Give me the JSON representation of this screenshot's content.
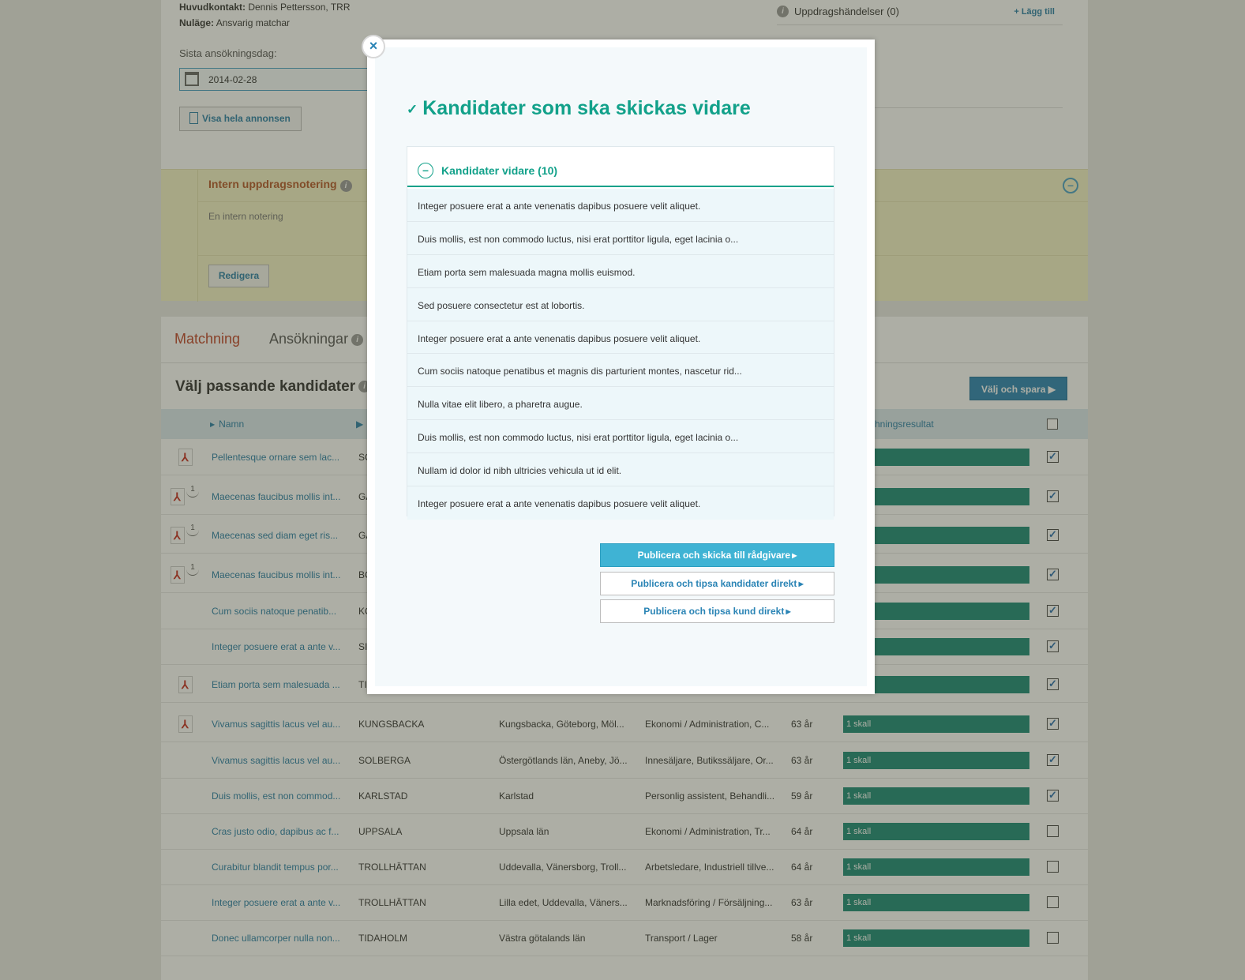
{
  "background": {
    "contact_label": "Huvudkontakt:",
    "contact_value": "Dennis Pettersson, TRR",
    "status_label": "Nuläge:",
    "status_value": "Ansvarig matchar",
    "deadline_label": "Sista ansökningsdag:",
    "deadline_value": "2014-02-28",
    "view_ad_label": "Visa hela annonsen",
    "events_label": "Uppdragshändelser (0)",
    "events_add": "+ Lägg till",
    "note_title": "Intern uppdragsnotering",
    "note_text": "En intern notering",
    "note_edit": "Redigera",
    "tab_matching": "Matchning",
    "tab_applications": "Ansökningar",
    "section_title": "Välj passande kandidater",
    "choose_save": "Välj och spara",
    "col_name": "Namn",
    "col_result": "hningsresultat",
    "rows": [
      {
        "name": "Pellentesque ornare sem lac...",
        "city": "SO",
        "area": "",
        "job": "",
        "age": "",
        "bar": "",
        "checked": "✓",
        "pdf": true,
        "one": false
      },
      {
        "name": "Maecenas faucibus mollis int...",
        "city": "GA",
        "area": "",
        "job": "",
        "age": "",
        "bar": "",
        "checked": "✓",
        "pdf": true,
        "one": true
      },
      {
        "name": "Maecenas sed diam eget ris...",
        "city": "GA",
        "area": "",
        "job": "",
        "age": "",
        "bar": "",
        "checked": "✓",
        "pdf": true,
        "one": true
      },
      {
        "name": "Maecenas faucibus mollis int...",
        "city": "BO",
        "area": "",
        "job": "",
        "age": "",
        "bar": "",
        "checked": "✓",
        "pdf": true,
        "one": true
      },
      {
        "name": "Cum sociis natoque penatib...",
        "city": "KO",
        "area": "",
        "job": "",
        "age": "",
        "bar": "",
        "checked": "✓",
        "pdf": false,
        "one": false
      },
      {
        "name": "Integer posuere erat a ante v...",
        "city": "SI",
        "area": "",
        "job": "",
        "age": "",
        "bar": "",
        "checked": "✓",
        "pdf": false,
        "one": false
      },
      {
        "name": "Etiam porta sem malesuada ...",
        "city": "TI",
        "area": "",
        "job": "",
        "age": "",
        "bar": "",
        "checked": "✓",
        "pdf": true,
        "one": false
      },
      {
        "name": "Vivamus sagittis lacus vel au...",
        "city": "KUNGSBACKA",
        "area": "Kungsbacka, Göteborg, Möl...",
        "job": "Ekonomi / Administration, C...",
        "age": "63 år",
        "bar": "1 skall",
        "checked": "✓",
        "pdf": true,
        "one": false
      },
      {
        "name": "Vivamus sagittis lacus vel au...",
        "city": "SOLBERGA",
        "area": "Östergötlands län, Aneby, Jö...",
        "job": "Innesäljare, Butikssäljare, Or...",
        "age": "63 år",
        "bar": "1 skall",
        "checked": "✓",
        "pdf": false,
        "one": false
      },
      {
        "name": "Duis mollis, est non commod...",
        "city": "KARLSTAD",
        "area": "Karlstad",
        "job": "Personlig assistent, Behandli...",
        "age": "59 år",
        "bar": "1 skall",
        "checked": "✓",
        "pdf": false,
        "one": false
      },
      {
        "name": "Cras justo odio, dapibus ac f...",
        "city": "UPPSALA",
        "area": "Uppsala län",
        "job": "Ekonomi / Administration, Tr...",
        "age": "64 år",
        "bar": "1 skall",
        "checked": "",
        "pdf": false,
        "one": false
      },
      {
        "name": "Curabitur blandit tempus por...",
        "city": "TROLLHÄTTAN",
        "area": "Uddevalla, Vänersborg, Troll...",
        "job": "Arbetsledare, Industriell tillve...",
        "age": "64 år",
        "bar": "1 skall",
        "checked": "",
        "pdf": false,
        "one": false
      },
      {
        "name": "Integer posuere erat a ante v...",
        "city": "TROLLHÄTTAN",
        "area": "Lilla edet, Uddevalla, Väners...",
        "job": "Marknadsföring / Försäljning...",
        "age": "63 år",
        "bar": "1 skall",
        "checked": "",
        "pdf": false,
        "one": false
      },
      {
        "name": "Donec ullamcorper nulla non...",
        "city": "TIDAHOLM",
        "area": "Västra götalands län",
        "job": "Transport / Lager",
        "age": "58 år",
        "bar": "1 skall",
        "checked": "",
        "pdf": false,
        "one": false
      }
    ]
  },
  "modal": {
    "close": "×",
    "title_check": "✓",
    "title": "Kandidater som ska skickas vidare",
    "panel_toggle": "–",
    "panel_title": "Kandidater vidare (10)",
    "candidates": [
      "Integer posuere erat a ante venenatis dapibus posuere velit aliquet.",
      "Duis mollis, est non commodo luctus, nisi erat porttitor ligula, eget lacinia o...",
      "Etiam porta sem malesuada magna mollis euismod.",
      "Sed posuere consectetur est at lobortis.",
      "Integer posuere erat a ante venenatis dapibus posuere velit aliquet.",
      "Cum sociis natoque penatibus et magnis dis parturient montes, nascetur rid...",
      "Nulla vitae elit libero, a pharetra augue.",
      "Duis mollis, est non commodo luctus, nisi erat porttitor ligula, eget lacinia o...",
      "Nullam id dolor id nibh ultricies vehicula ut id elit.",
      "Integer posuere erat a ante venenatis dapibus posuere velit aliquet."
    ],
    "btn_advisor": "Publicera och skicka till rådgivare",
    "btn_candidates": "Publicera och tipsa kandidater direkt",
    "btn_client": "Publicera och tipsa kund direkt"
  },
  "colors": {
    "accent_green": "#12a18a",
    "link_blue": "#2a84b5",
    "note_bg": "#f5f3c9",
    "result_bar": "#1a8b78"
  },
  "icons": [
    "calendar-icon",
    "document-icon",
    "info-icon",
    "pdf-icon",
    "checkmark-icon",
    "close-icon",
    "collapse-icon"
  ]
}
